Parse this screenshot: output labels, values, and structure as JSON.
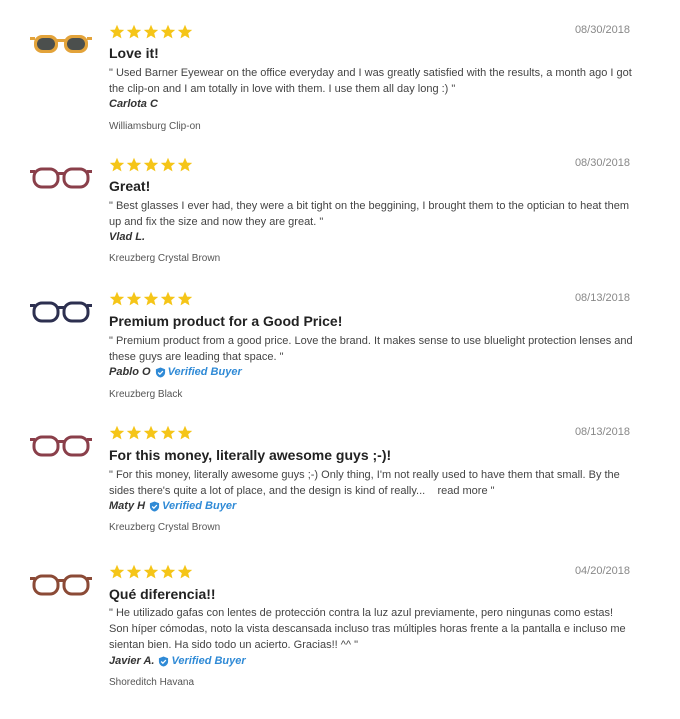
{
  "reviews": [
    {
      "rating": 5,
      "date": "08/30/2018",
      "title": "Love it!",
      "body": "\" Used Barner Eyewear on the office everyday and I was greatly satisfied with the results, a month ago I got the clip-on and I am totally in love with them. I use them all day long :) \"",
      "author": "Carlota C",
      "verified": false,
      "product": "Williamsburg Clip-on",
      "frame_color": "#e3a33a",
      "lens_color": "#4b4f4d",
      "thumbnail_icon": "sunglasses-clip-on-icon"
    },
    {
      "rating": 5,
      "date": "08/30/2018",
      "title": "Great!",
      "body": "\" Best glasses I ever had, they were a bit tight on the beggining, I brought them to the optician to heat them up and fix the size and now they are great. \"",
      "author": "Vlad L.",
      "verified": false,
      "product": "Kreuzberg Crystal Brown",
      "frame_color": "#8a3f4a",
      "lens_color": "none",
      "thumbnail_icon": "glasses-icon"
    },
    {
      "rating": 5,
      "date": "08/13/2018",
      "title": "Premium product for a Good Price!",
      "body": "\" Premium product from a good price. Love the brand. It makes sense to use bluelight protection lenses and these guys are leading that space. \"",
      "author": "Pablo O",
      "verified": true,
      "verified_label": "Verified Buyer",
      "product": "Kreuzberg Black",
      "frame_color": "#2d3050",
      "lens_color": "none",
      "thumbnail_icon": "glasses-icon"
    },
    {
      "rating": 5,
      "date": "08/13/2018",
      "title": "For this money, literally awesome guys ;-)!",
      "body": "\" For this money, literally awesome guys ;-) Only thing, I'm not really used to have them that small. By the sides there's quite a lot of place, and the design is kind of really...",
      "read_more": "read more \"",
      "author": "Maty H",
      "verified": true,
      "verified_label": "Verified Buyer",
      "product": "Kreuzberg Crystal Brown",
      "frame_color": "#8a3f4a",
      "lens_color": "none",
      "thumbnail_icon": "glasses-icon"
    },
    {
      "rating": 5,
      "date": "04/20/2018",
      "title": "Qué diferencia!!",
      "body": "\" He utilizado gafas con lentes de protección contra la luz azul previamente, pero ningunas como estas! Son híper cómodas, noto la vista descansada incluso tras múltiples horas frente a la pantalla e incluso me sientan bien. Ha sido todo un acierto. Gracias!! ^^ \"",
      "author": "Javier A.",
      "verified": true,
      "verified_label": "Verified Buyer",
      "product": "Shoreditch Havana",
      "frame_color": "#8b4a36",
      "lens_color": "none",
      "thumbnail_icon": "glasses-icon"
    }
  ],
  "star_color": "#f5c518"
}
